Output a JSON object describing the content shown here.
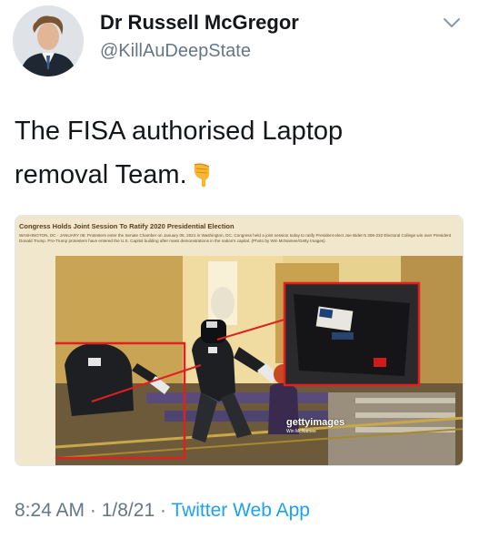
{
  "author": {
    "display_name": "Dr Russell McGregor",
    "handle": "@KillAuDeepState",
    "avatar_icon": "profile-photo"
  },
  "menu_icon": "chevron-down-icon",
  "tweet": {
    "text": "The FISA authorised Laptop removal Team.",
    "emoji_icon": "pointing-down-hand-icon"
  },
  "media": {
    "caption": "Congress Holds Joint Session To Ratify 2020 Presidential Election",
    "subcaption": "WASHINGTON, DC - JANUARY 06: Protesters enter the Senate Chamber on January 06, 2021 in Washington, DC. Congress held a joint session today to ratify President-elect Joe Biden's 306-232 Electoral College win over President Donald Trump. Pro-Trump protesters have entered the U.S. Capitol building after mass demonstrations in the nation's capital. (Photo by Win McNamee/Getty Images)",
    "watermark": "gettyimages",
    "watermark_credit": "Win McNamee",
    "highlight_color": "#e02020"
  },
  "footer": {
    "time": "8:24 AM",
    "sep1": " · ",
    "date": "1/8/21",
    "sep2": " · ",
    "app": "Twitter Web App"
  },
  "colors": {
    "link": "#1da1f2",
    "secondary_text": "#657786"
  }
}
